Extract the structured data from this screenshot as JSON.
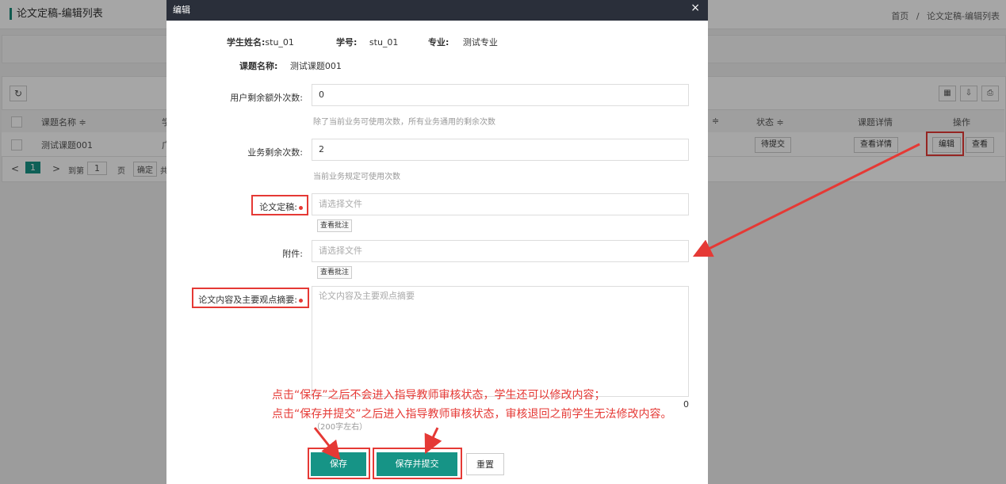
{
  "page": {
    "title": "论文定稿-编辑列表",
    "breadcrumb_home": "首页",
    "breadcrumb_sep": "/",
    "breadcrumb_current": "论文定稿-编辑列表"
  },
  "table": {
    "headers": {
      "topic": "课题名称 ≑",
      "partial": "学",
      "status": "状态 ≑",
      "detail": "课题详情",
      "ops": "操作",
      "sort_tail": "≑"
    },
    "row": {
      "topic": "测试课题001",
      "partial": "广",
      "status_btn": "待提交",
      "detail_btn": "查看详情",
      "edit_btn": "编辑",
      "view_btn": "查看"
    }
  },
  "pager": {
    "prev": "<",
    "page": "1",
    "next": ">",
    "goto": "到第",
    "page_input": "1",
    "page_unit": "页",
    "confirm": "确定",
    "tail": "共"
  },
  "modal": {
    "title": "编辑",
    "close": "×",
    "student_name_label": "学生姓名:",
    "student_name": "stu_01",
    "student_id_label": "学号:",
    "student_id": "stu_01",
    "major_label": "专业:",
    "major": "测试专业",
    "topic_label": "课题名称:",
    "topic": "测试课题001",
    "extra_count_label": "用户剩余额外次数:",
    "extra_count": "0",
    "extra_count_hint": "除了当前业务可使用次数，所有业务通用的剩余次数",
    "biz_count_label": "业务剩余次数:",
    "biz_count": "2",
    "biz_count_hint": "当前业务规定可使用次数",
    "final_paper_label": "论文定稿:",
    "final_paper_placeholder": "请选择文件",
    "final_paper_note_btn": "查看批注",
    "attachment_label": "附件:",
    "attachment_placeholder": "请选择文件",
    "attachment_note_btn": "查看批注",
    "summary_label": "论文内容及主要观点摘要:",
    "summary_placeholder": "论文内容及主要观点摘要",
    "summary_counter": "0",
    "summary_hint": "（200字左右）",
    "save_btn": "保存",
    "save_submit_btn": "保存并提交",
    "reset_btn": "重置"
  },
  "annotation": {
    "line1": "点击“保存”之后不会进入指导教师审核状态，学生还可以修改内容；",
    "line2": "点击“保存并提交”之后进入指导教师审核状态，审核退回之前学生无法修改内容。"
  },
  "colors": {
    "accent": "#169486",
    "annotation": "#e53935",
    "modal_header": "#2a2f3a"
  },
  "icons": [
    "refresh-icon",
    "columns-icon",
    "export-icon",
    "print-icon",
    "close-icon",
    "chevron-left-icon",
    "chevron-right-icon",
    "sort-icon",
    "arrow-icon"
  ]
}
